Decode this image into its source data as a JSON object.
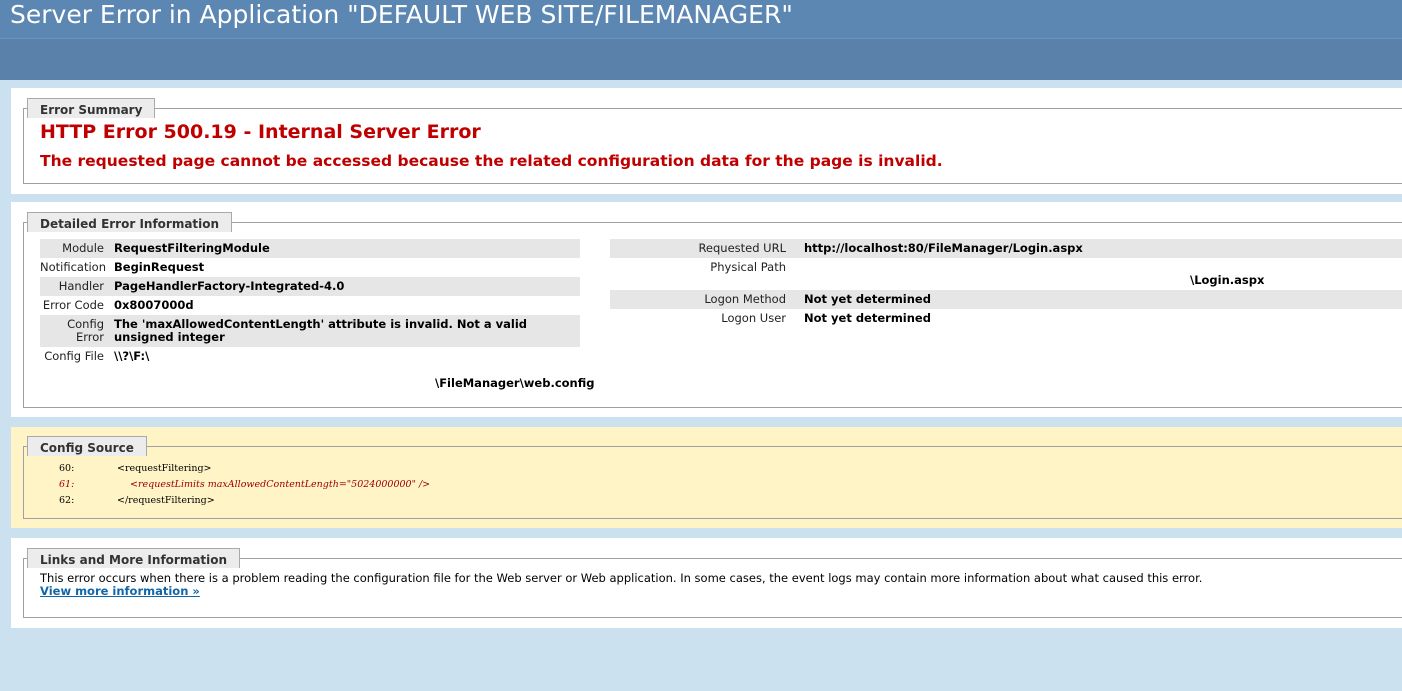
{
  "header": {
    "title": "Server Error in Application \"DEFAULT WEB SITE/FILEMANAGER\""
  },
  "error_summary": {
    "legend": "Error Summary",
    "title": "HTTP Error 500.19 - Internal Server Error",
    "subtitle": "The requested page cannot be accessed because the related configuration data for the page is invalid."
  },
  "detailed": {
    "legend": "Detailed Error Information",
    "left": {
      "module_label": "Module",
      "module_value": "RequestFilteringModule",
      "notification_label": "Notification",
      "notification_value": "BeginRequest",
      "handler_label": "Handler",
      "handler_value": "PageHandlerFactory-Integrated-4.0",
      "error_code_label": "Error Code",
      "error_code_value": "0x8007000d",
      "config_error_label_1": "Config",
      "config_error_label_2": "Error",
      "config_error_value_1": "The 'maxAllowedContentLength' attribute is invalid. Not a valid",
      "config_error_value_2": "unsigned integer",
      "config_file_label": "Config File",
      "config_file_value_1": "\\\\?\\F:\\",
      "config_file_value_3": "\\FileManager\\web.config"
    },
    "right": {
      "requested_url_label": "Requested URL",
      "requested_url_value": "http://localhost:80/FileManager/Login.aspx",
      "physical_path_label": "Physical Path",
      "physical_path_value_2": "\\Login.aspx",
      "logon_method_label": "Logon Method",
      "logon_method_value": "Not yet determined",
      "logon_user_label": "Logon User",
      "logon_user_value": "Not yet determined"
    }
  },
  "config_source": {
    "legend": "Config Source",
    "lines": [
      {
        "num": "60:",
        "code": "<requestFiltering>"
      },
      {
        "num": "61:",
        "code": "<requestLimits maxAllowedContentLength=\"5024000000\" />"
      },
      {
        "num": "62:",
        "code": "</requestFiltering>"
      }
    ]
  },
  "links": {
    "legend": "Links and More Information",
    "text": "This error occurs when there is a problem reading the configuration file for the Web server or Web application. In some cases, the event logs may contain more information about what caused this error.",
    "more_link": "View more information »"
  },
  "colors": {
    "header_bg": "#5c87b2",
    "page_bg": "#cbe1ef",
    "error_red": "#c00000",
    "source_bg": "#fff4c6",
    "link_blue": "#1066a8"
  }
}
